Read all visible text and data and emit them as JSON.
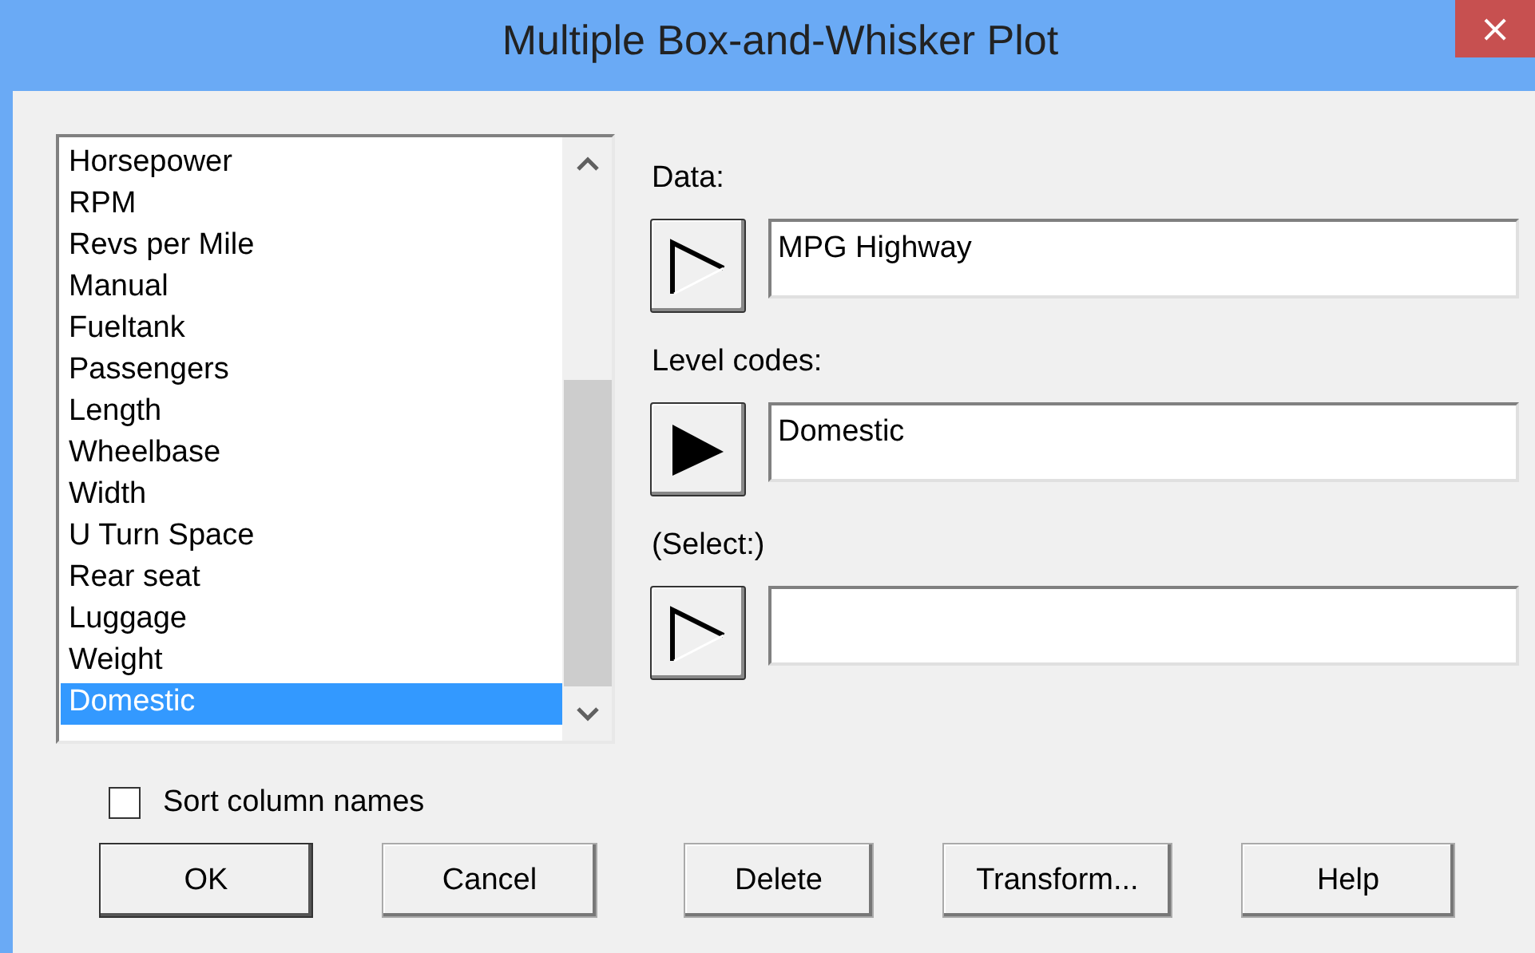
{
  "window": {
    "title": "Multiple Box-and-Whisker Plot",
    "close": "×"
  },
  "variables": [
    {
      "label": "Horsepower",
      "selected": false
    },
    {
      "label": "RPM",
      "selected": false
    },
    {
      "label": "Revs per Mile",
      "selected": false
    },
    {
      "label": "Manual",
      "selected": false
    },
    {
      "label": "Fueltank",
      "selected": false
    },
    {
      "label": "Passengers",
      "selected": false
    },
    {
      "label": "Length",
      "selected": false
    },
    {
      "label": "Wheelbase",
      "selected": false
    },
    {
      "label": "Width",
      "selected": false
    },
    {
      "label": "U Turn Space",
      "selected": false
    },
    {
      "label": "Rear seat",
      "selected": false
    },
    {
      "label": "Luggage",
      "selected": false
    },
    {
      "label": "Weight",
      "selected": false
    },
    {
      "label": "Domestic",
      "selected": true
    }
  ],
  "fields": [
    {
      "label": "Data:",
      "value": "MPG Highway",
      "filled": false
    },
    {
      "label": "Level codes:",
      "value": "Domestic",
      "filled": true
    },
    {
      "label": "(Select:)",
      "filled": false
    }
  ],
  "sort_column_names": {
    "label": "Sort column names",
    "checked": false
  },
  "buttons": [
    {
      "label": "OK",
      "default": true
    },
    {
      "label": "Cancel",
      "default": false
    },
    {
      "label": "Delete",
      "default": false
    },
    {
      "label": "Transform...",
      "default": false
    },
    {
      "label": "Help",
      "default": false
    }
  ]
}
